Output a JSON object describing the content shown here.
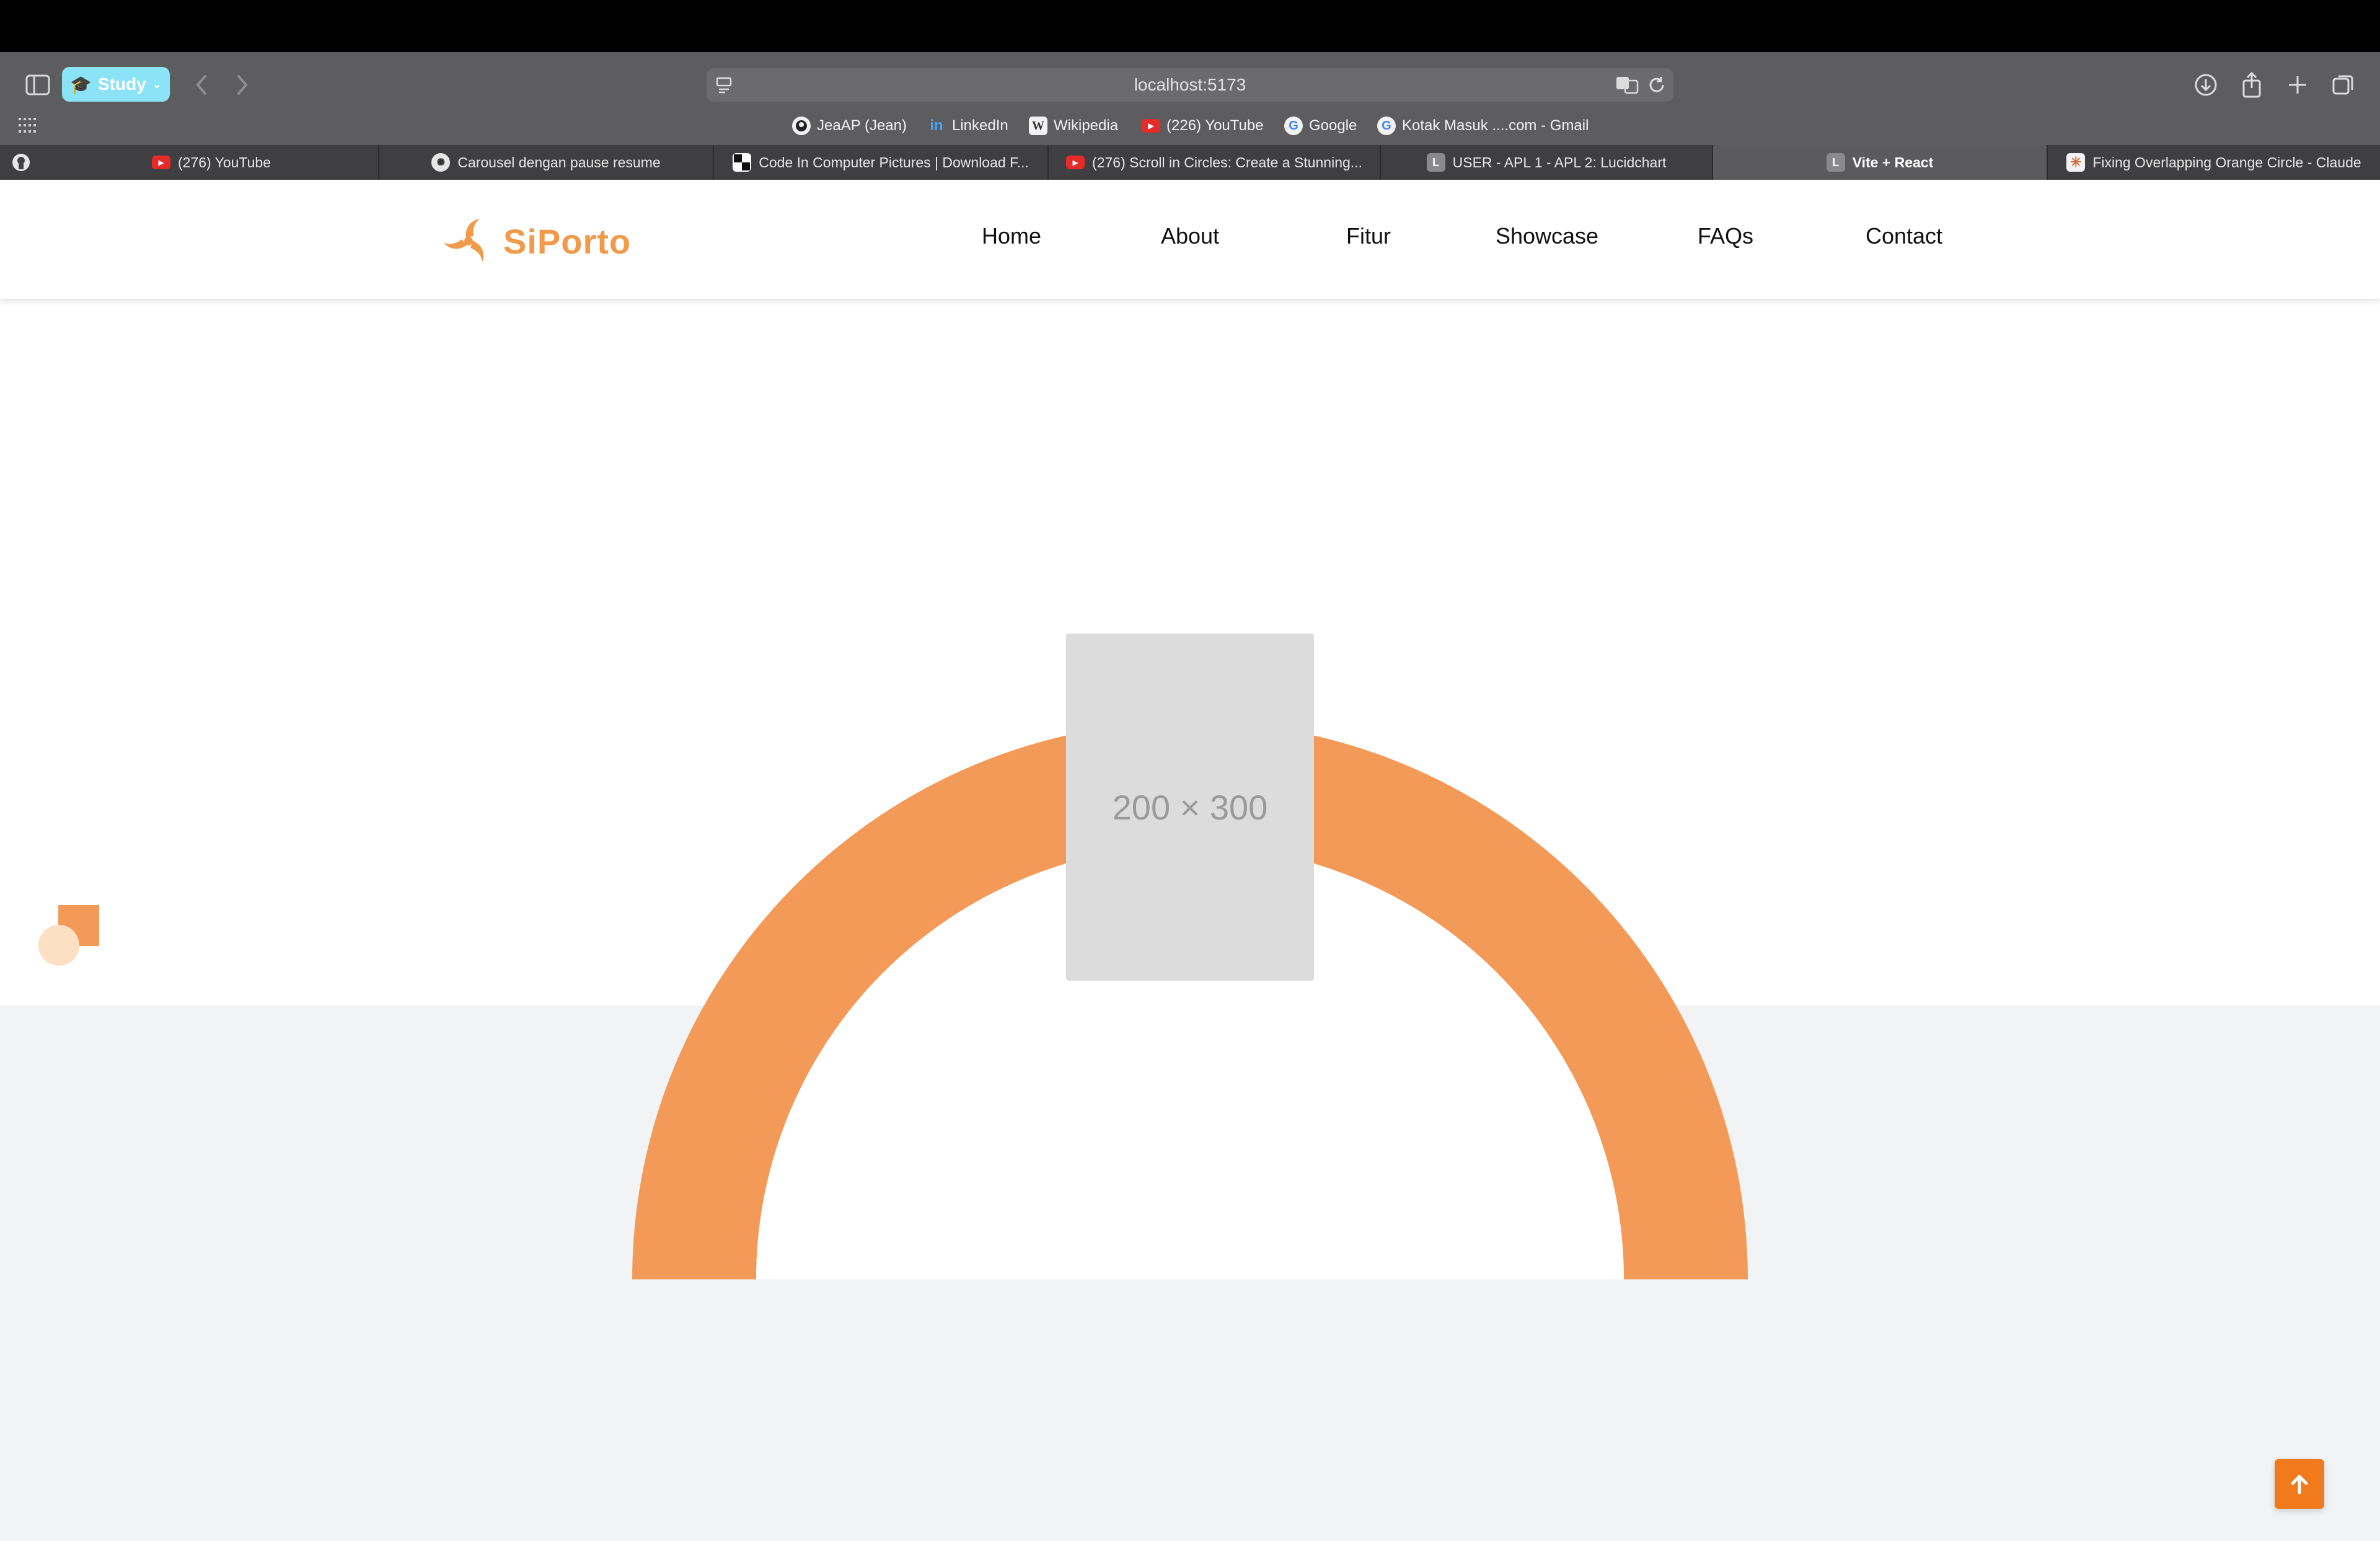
{
  "browser": {
    "profile_label": "Study",
    "address": "localhost:5173",
    "bookmarks": [
      {
        "label": "JeaAP (Jean)",
        "icon": "github-icon"
      },
      {
        "label": "LinkedIn",
        "icon": "linkedin-icon"
      },
      {
        "label": "Wikipedia",
        "icon": "wikipedia-icon"
      },
      {
        "label": "(226) YouTube",
        "icon": "youtube-icon"
      },
      {
        "label": "Google",
        "icon": "google-icon"
      },
      {
        "label": "Kotak Masuk ....com - Gmail",
        "icon": "google-icon"
      }
    ],
    "tabs": [
      {
        "label": "(276) YouTube",
        "icon": "youtube-icon",
        "active": false
      },
      {
        "label": "Carousel dengan pause resume",
        "icon": "chatgpt-icon",
        "active": false
      },
      {
        "label": "Code In Computer Pictures | Download F...",
        "icon": "freepik-icon",
        "active": false
      },
      {
        "label": "(276) Scroll in Circles: Create a Stunning...",
        "icon": "youtube-icon",
        "active": false
      },
      {
        "label": "USER - APL 1 - APL 2: Lucidchart",
        "icon": "lucidchart-icon",
        "active": false,
        "fav_letter": "L"
      },
      {
        "label": "Vite + React",
        "icon": "vite-icon",
        "active": true,
        "fav_letter": "L"
      },
      {
        "label": "Fixing Overlapping Orange Circle - Claude",
        "icon": "claude-icon",
        "active": false
      }
    ]
  },
  "site": {
    "logo_text": "SiPorto",
    "nav": [
      "Home",
      "About",
      "Fitur",
      "Showcase",
      "FAQs",
      "Contact"
    ],
    "placeholder_label": "200 × 300",
    "colors": {
      "accent": "#f39a58",
      "logo": "#f09a4a",
      "button": "#f07a1c",
      "placeholder": "#dcdcdc",
      "section_bg": "#f2f3f5"
    }
  }
}
